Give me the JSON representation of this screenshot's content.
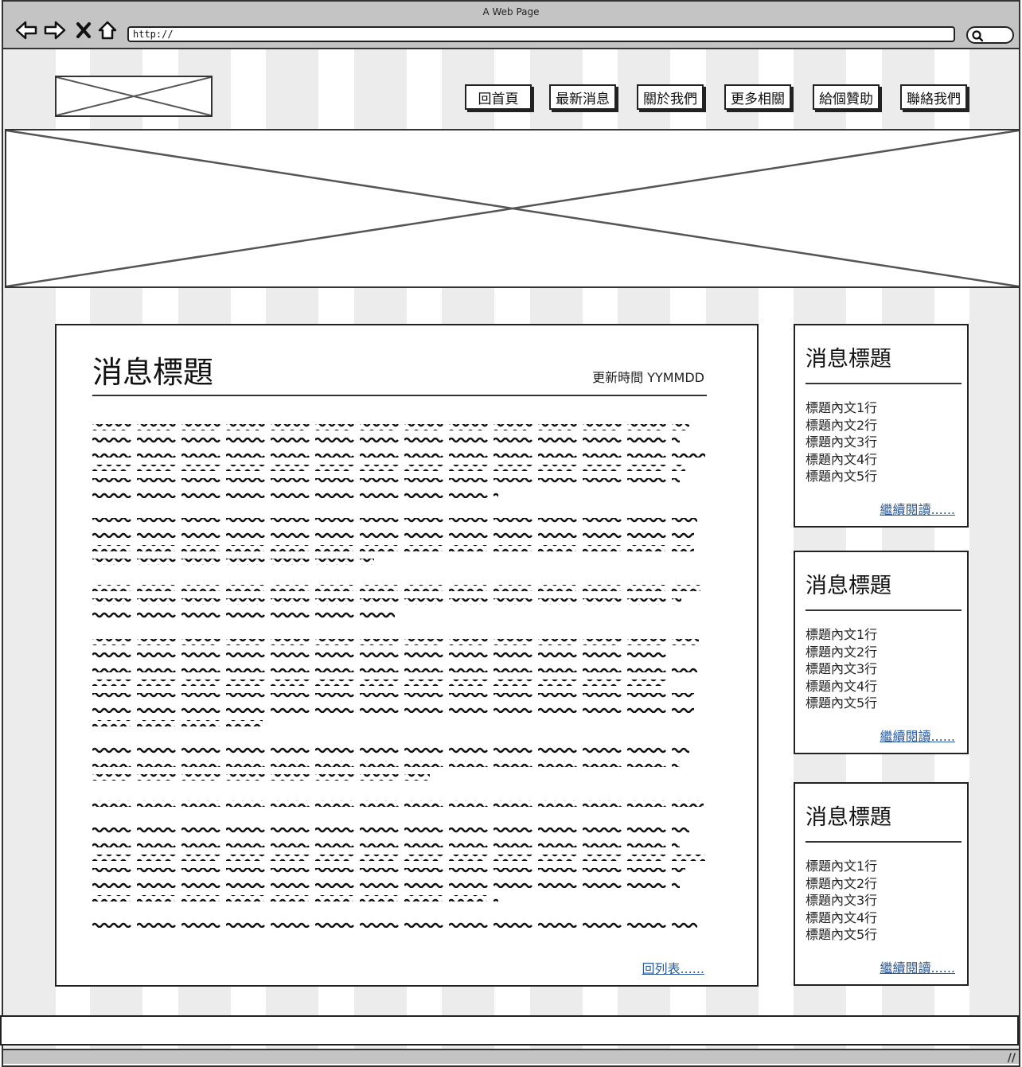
{
  "window": {
    "title": "A Web Page"
  },
  "browser": {
    "url": "http://",
    "icons": [
      "back-arrow-icon",
      "forward-arrow-icon",
      "close-x-icon",
      "home-icon",
      "search-icon"
    ]
  },
  "nav": {
    "items": [
      "回首頁",
      "最新消息",
      "關於我們",
      "更多相關",
      "給個贊助",
      "聯絡我們"
    ]
  },
  "article": {
    "title": "消息標題",
    "updated": "更新時間 YYMMDD",
    "back_link": "回列表......"
  },
  "sidebar": {
    "cards": [
      {
        "title": "消息標題",
        "lines": [
          "標題內文1行",
          "標題內文2行",
          "標題內文3行",
          "標題內文4行",
          "標題內文5行"
        ],
        "more": "繼續閱讀......"
      },
      {
        "title": "消息標題",
        "lines": [
          "標題內文1行",
          "標題內文2行",
          "標題內文3行",
          "標題內文4行",
          "標題內文5行"
        ],
        "more": "繼續閱讀......"
      },
      {
        "title": "消息標題",
        "lines": [
          "標題內文1行",
          "標題內文2行",
          "標題內文3行",
          "標題內文4行",
          "標題內文5行"
        ],
        "more": "繼續閱讀......"
      }
    ]
  }
}
